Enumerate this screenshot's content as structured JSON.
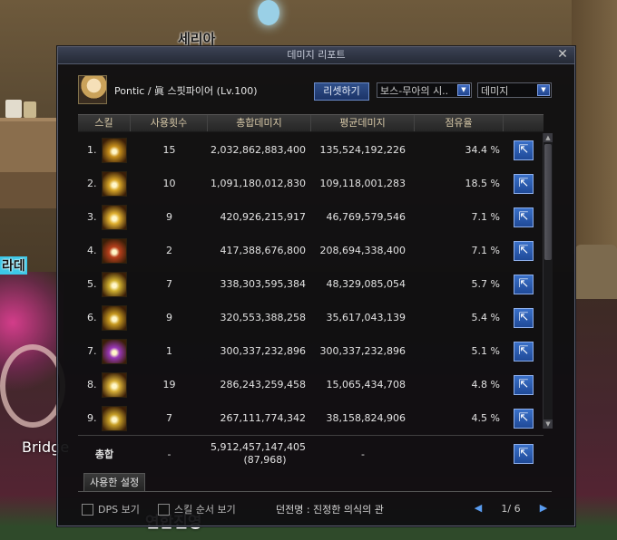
{
  "colors": {
    "accent": "#2a5cb0",
    "window_bg": "#0e0e10",
    "header_text": "#d8c9a8"
  },
  "world": {
    "npc_top": "세리아",
    "npc_left": "라데",
    "bridge": "Bridge",
    "npc_bottom": "연합진영"
  },
  "window": {
    "title": "데미지 리포트",
    "close_icon": "close-icon"
  },
  "character": {
    "label": "Pontic / 眞 스핏파이어 (Lv.100)"
  },
  "controls": {
    "reset_label": "리셋하기",
    "boss_select": "보스-무아의 시..",
    "type_select": "데미지"
  },
  "table": {
    "headers": [
      "스킬",
      "사용횟수",
      "총합데미지",
      "평균데미지",
      "점유율",
      ""
    ],
    "rows": [
      {
        "rank": "1.",
        "count": "15",
        "total": "2,032,862,883,400",
        "avg": "135,524,192,226",
        "share": "34.4 %",
        "icon": "skill-fire-burst-icon",
        "color": "#c8901c"
      },
      {
        "rank": "2.",
        "count": "10",
        "total": "1,091,180,012,830",
        "avg": "109,118,001,283",
        "share": "18.5 %",
        "icon": "skill-bullet-rain-icon",
        "color": "#d8a628"
      },
      {
        "rank": "3.",
        "count": "9",
        "total": "420,926,215,917",
        "avg": "46,769,579,546",
        "share": "7.1 %",
        "icon": "skill-grenade-icon",
        "color": "#e0b030"
      },
      {
        "rank": "4.",
        "count": "2",
        "total": "417,388,676,800",
        "avg": "208,694,338,400",
        "share": "7.1 %",
        "icon": "skill-explosion-icon",
        "color": "#b8401c"
      },
      {
        "rank": "5.",
        "count": "7",
        "total": "338,303,595,384",
        "avg": "48,329,085,054",
        "share": "5.7 %",
        "icon": "skill-flash-icon",
        "color": "#d0b030"
      },
      {
        "rank": "6.",
        "count": "9",
        "total": "320,553,388,258",
        "avg": "35,617,043,139",
        "share": "5.4 %",
        "icon": "skill-spark-icon",
        "color": "#c89a20"
      },
      {
        "rank": "7.",
        "count": "1",
        "total": "300,337,232,896",
        "avg": "300,337,232,896",
        "share": "5.1 %",
        "icon": "skill-purple-slash-icon",
        "color": "#9a38b8"
      },
      {
        "rank": "8.",
        "count": "19",
        "total": "286,243,259,458",
        "avg": "15,065,434,708",
        "share": "4.8 %",
        "icon": "skill-shot-icon",
        "color": "#d8b038"
      },
      {
        "rank": "9.",
        "count": "7",
        "total": "267,111,774,342",
        "avg": "38,158,824,906",
        "share": "4.5 %",
        "icon": "skill-blast-icon",
        "color": "#c8a028"
      }
    ],
    "share_icon": "share-icon"
  },
  "total": {
    "label": "총합",
    "count": "-",
    "damage": "5,912,457,147,405",
    "damage_count": "(87,968)",
    "avg": "-"
  },
  "tabs": {
    "used_settings": "사용한 설정"
  },
  "footer": {
    "dps_label": "DPS 보기",
    "order_label": "스킬 순서 보기",
    "dungeon": "던전명 : 진정한 의식의 관",
    "page": "1/ 6"
  }
}
